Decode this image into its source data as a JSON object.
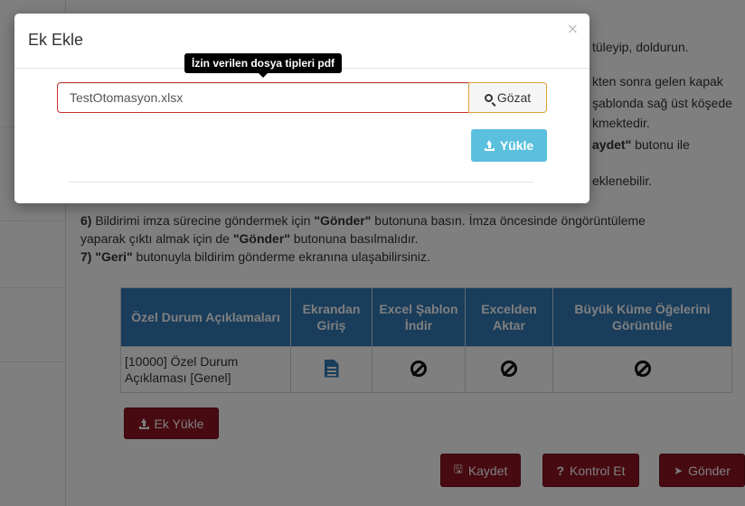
{
  "background": {
    "instructions": {
      "line1_tail": "tüleyip, doldurun.",
      "line2_tail": "kten sonra gelen kapak",
      "line3_tail": "şablonda sağ üst köşede",
      "line4_tail": "kmektedir.",
      "line5_bold": "aydet\"",
      "line5_rest": " butonu ile",
      "line6_tail": "eklenebilir.",
      "step6_num": "6)",
      "step6_a": " Bildirimi imza sürecine göndermek için ",
      "step6_b": "\"Gönder\"",
      "step6_c": " butonuna basın. İmza öncesinde öngörüntüleme",
      "step6_d": "yaparak çıktı almak için de ",
      "step6_e": "\"Gönder\"",
      "step6_f": " butonuna basılmalıdır.",
      "step7_num": "7)",
      "step7_b": " \"Geri\"",
      "step7_rest": " butonuyla bildirim gönderme ekranına ulaşabilirsiniz."
    },
    "table": {
      "headers": [
        "Özel Durum Açıklamaları",
        "Ekrandan Giriş",
        "Excel Şablon İndir",
        "Excelden Aktar",
        "Büyük Küme Öğelerini Görüntüle"
      ],
      "row_label": "[10000] Özel Durum Açıklaması [Genel]"
    },
    "ek_yukle_label": "Ek Yükle",
    "kaydet_label": "Kaydet",
    "kontrol_label": "Kontrol Et",
    "gonder_label": "Gönder"
  },
  "modal": {
    "title": "Ek Ekle",
    "close_symbol": "×",
    "tooltip": "İzin verilen dosya tipleri pdf",
    "file_value": "TestOtomasyon.xlsx",
    "browse_label": "Gözat",
    "upload_label": "Yükle"
  }
}
